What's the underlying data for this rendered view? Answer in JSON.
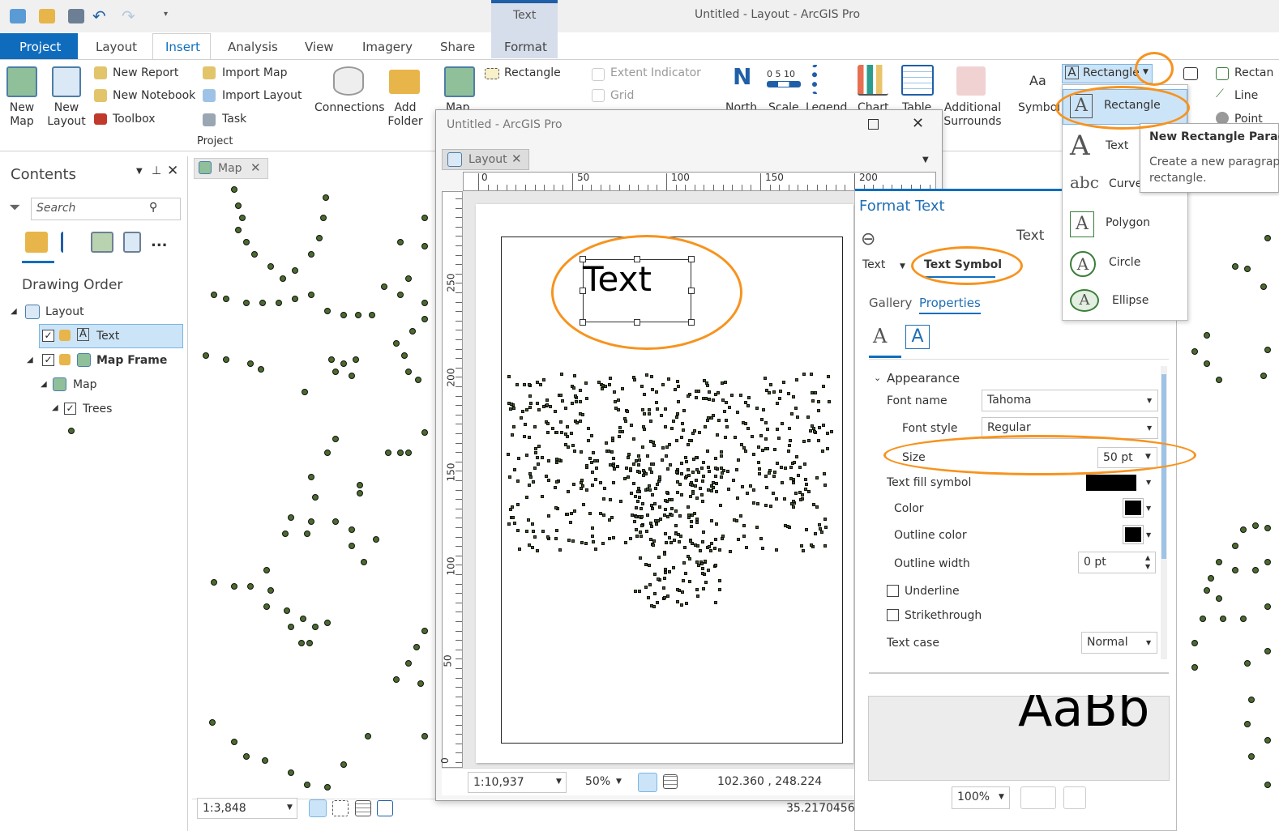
{
  "window_title": "Untitled - Layout - ArcGIS Pro",
  "context_tab": {
    "group": "Text",
    "tab": "Format"
  },
  "ribbon_tabs": [
    "Project",
    "Layout",
    "Insert",
    "Analysis",
    "View",
    "Imagery",
    "Share"
  ],
  "ribbon": {
    "new_map": "New\nMap",
    "new_layout": "New\nLayout",
    "new_report": "New Report",
    "new_notebook": "New Notebook",
    "toolbox": "Toolbox",
    "import_map": "Import Map",
    "import_layout": "Import Layout",
    "task": "Task",
    "connections": "Connections",
    "add_folder": "Add\nFolder",
    "group_project": "Project",
    "map_frame": "Map",
    "rectangle": "Rectangle",
    "extent_indicator": "Extent Indicator",
    "grid": "Grid",
    "north": "North",
    "scale": "Scale",
    "scale_ticks": "0  5 10",
    "legend": "Legend",
    "chart": "Chart",
    "table": "Table",
    "additional_surrounds": "Additional\nSurrounds",
    "symbol": "Symbol",
    "symbol_aa": "Aa",
    "rectangle_dd": "Rectangle",
    "rectangle_right": "Rectan",
    "line": "Line",
    "point": "Point"
  },
  "contents": {
    "title": "Contents",
    "search_placeholder": "Search",
    "more": "...",
    "drawing_order": "Drawing Order",
    "tree": [
      {
        "label": "Layout"
      },
      {
        "label": "Text"
      },
      {
        "label": "Map Frame"
      },
      {
        "label": "Map"
      },
      {
        "label": "Trees"
      }
    ]
  },
  "map_tab": "Map",
  "map_scale": "1:3,848",
  "map_coords": "35.2170456°",
  "float_window": {
    "title": "Untitled - ArcGIS Pro",
    "layout_tab": "Layout",
    "ruler_h": [
      "0",
      "50",
      "100",
      "150",
      "200"
    ],
    "ruler_v": [
      "250",
      "200",
      "150",
      "100",
      "50",
      "0"
    ],
    "page_text": "Text",
    "scale": "1:10,937",
    "zoom": "50%",
    "coords": "102.360 , 248.224"
  },
  "format_text": {
    "title": "Format Text",
    "subtitle": "Text",
    "back_label": "Text",
    "tab_symbol": "Text Symbol",
    "tab_gallery": "Gallery",
    "tab_properties": "Properties",
    "section_appearance": "Appearance",
    "font_name_label": "Font name",
    "font_name": "Tahoma",
    "font_style_label": "Font style",
    "font_style": "Regular",
    "size_label": "Size",
    "size": "50 pt",
    "fill_label": "Text fill symbol",
    "color_label": "Color",
    "outline_color_label": "Outline color",
    "outline_width_label": "Outline width",
    "outline_width": "0 pt",
    "underline_label": "Underline",
    "strikethrough_label": "Strikethrough",
    "text_case_label": "Text case",
    "text_case": "Normal",
    "preview_text": "AaBb",
    "preview_zoom": "100%"
  },
  "shape_menu": {
    "items": [
      {
        "label": "Rectangle"
      },
      {
        "label": "Text"
      },
      {
        "label": "Curve"
      },
      {
        "label": "Polygon"
      },
      {
        "label": "Circle"
      },
      {
        "label": "Ellipse"
      }
    ]
  },
  "tooltip": {
    "title": "New Rectangle Parag",
    "body": "Create a new paragrap rectangle."
  },
  "colors": {
    "accent": "#106ebe",
    "project_tab": "#0f6cbd",
    "annotation": "#f7931e",
    "selected": "#cce4f7",
    "point_fill": "#4a6b2e"
  }
}
